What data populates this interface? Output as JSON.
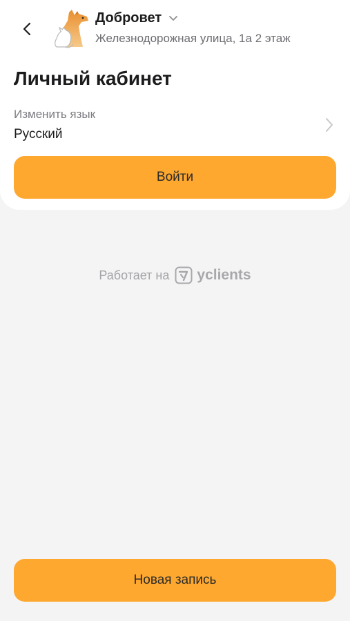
{
  "header": {
    "back_icon": "chevron-left-icon",
    "logo_icon": "dog-cat-logo-icon",
    "branch_name": "Добровет",
    "branch_dropdown_icon": "chevron-down-icon",
    "branch_address": "Железнодорожная улица, 1а 2 этаж"
  },
  "page_title": "Личный кабинет",
  "language": {
    "label": "Изменить язык",
    "value": "Русский",
    "arrow_icon": "chevron-right-icon"
  },
  "login_button": "Войти",
  "powered": {
    "text": "Работает на",
    "brand_icon": "yclients-logo-icon",
    "brand": "yclients"
  },
  "new_booking_button": "Новая запись",
  "colors": {
    "accent": "#fea82f",
    "background": "#f4f4f5",
    "card": "#ffffff",
    "text": "#1c1c1e",
    "secondary_text": "#7a7a80"
  }
}
